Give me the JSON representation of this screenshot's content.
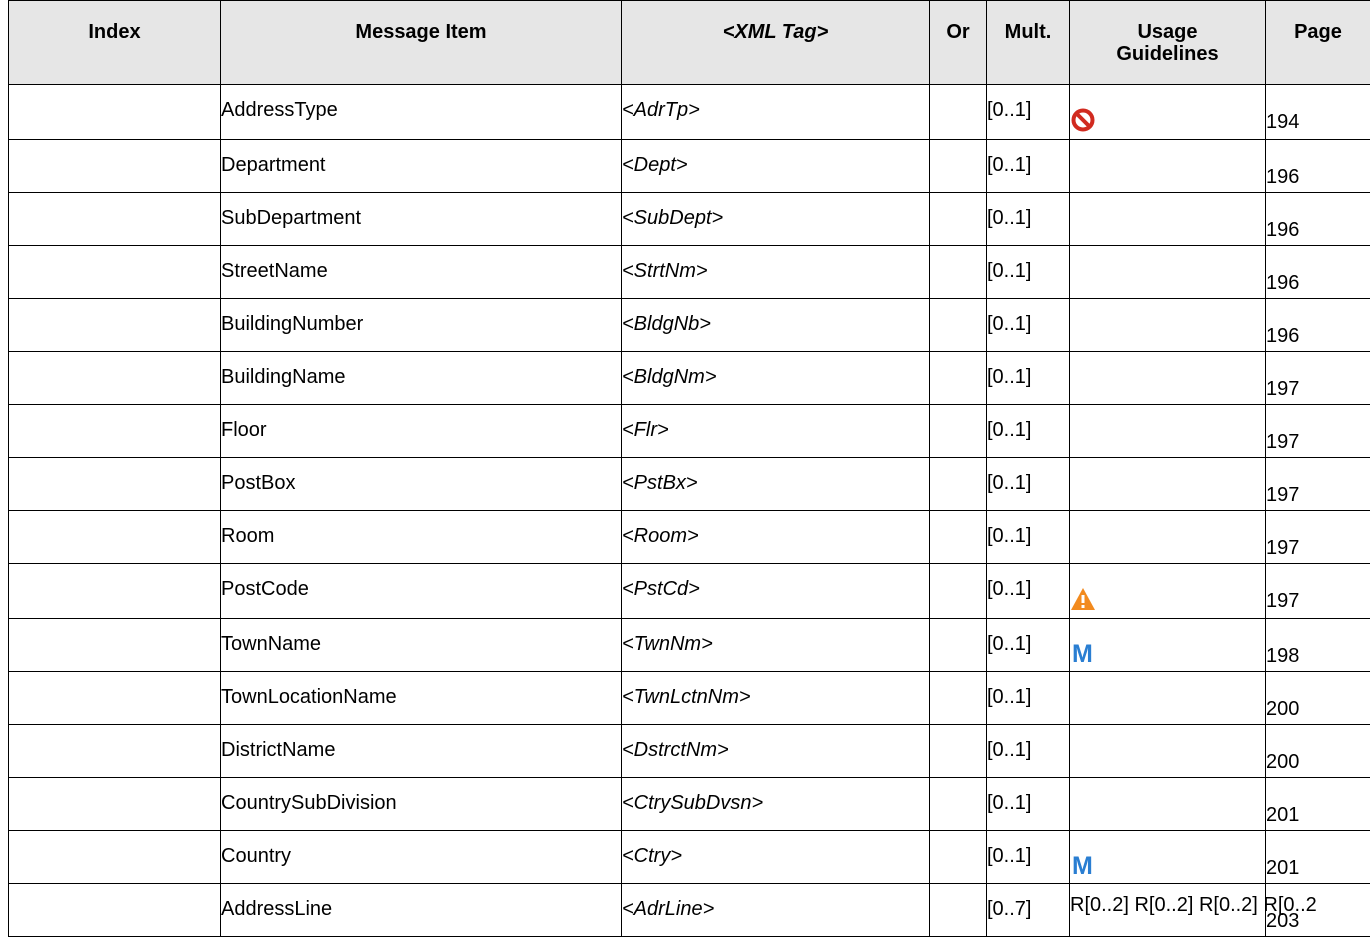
{
  "header": {
    "index": "Index",
    "message_item": "Message Item",
    "xml_tag": "<XML Tag>",
    "or": "Or",
    "mult": "Mult.",
    "usage_line1": "Usage",
    "usage_line2": "Guidelines",
    "page": "Page"
  },
  "rows": [
    {
      "item": "AddressType",
      "tag": "<AdrTp>",
      "mult": "[0..1]",
      "usage_icon": "prohibited-icon",
      "page": "194"
    },
    {
      "item": "Department",
      "tag": "<Dept>",
      "mult": "[0..1]",
      "usage_icon": "",
      "page": "196"
    },
    {
      "item": "SubDepartment",
      "tag": "<SubDept>",
      "mult": "[0..1]",
      "usage_icon": "",
      "page": "196"
    },
    {
      "item": "StreetName",
      "tag": "<StrtNm>",
      "mult": "[0..1]",
      "usage_icon": "",
      "page": "196"
    },
    {
      "item": "BuildingNumber",
      "tag": "<BldgNb>",
      "mult": "[0..1]",
      "usage_icon": "",
      "page": "196"
    },
    {
      "item": "BuildingName",
      "tag": "<BldgNm>",
      "mult": "[0..1]",
      "usage_icon": "",
      "page": "197"
    },
    {
      "item": "Floor",
      "tag": "<Flr>",
      "mult": "[0..1]",
      "usage_icon": "",
      "page": "197"
    },
    {
      "item": "PostBox",
      "tag": "<PstBx>",
      "mult": "[0..1]",
      "usage_icon": "",
      "page": "197"
    },
    {
      "item": "Room",
      "tag": "<Room>",
      "mult": "[0..1]",
      "usage_icon": "",
      "page": "197"
    },
    {
      "item": "PostCode",
      "tag": "<PstCd>",
      "mult": "[0..1]",
      "usage_icon": "warning-icon",
      "page": "197"
    },
    {
      "item": "TownName",
      "tag": "<TwnNm>",
      "mult": "[0..1]",
      "usage_icon": "m-icon",
      "page": "198"
    },
    {
      "item": "TownLocationName",
      "tag": "<TwnLctnNm>",
      "mult": "[0..1]",
      "usage_icon": "",
      "page": "200"
    },
    {
      "item": "DistrictName",
      "tag": "<DstrctNm>",
      "mult": "[0..1]",
      "usage_icon": "",
      "page": "200"
    },
    {
      "item": "CountrySubDivision",
      "tag": "<CtrySubDvsn>",
      "mult": "[0..1]",
      "usage_icon": "",
      "page": "201"
    },
    {
      "item": "Country",
      "tag": "<Ctry>",
      "mult": "[0..1]",
      "usage_icon": "m-icon",
      "page": "201"
    },
    {
      "item": "AddressLine",
      "tag": "<AdrLine>",
      "mult": "[0..7]",
      "usage_icon": "",
      "usage_text": "R[0..2] R[0..2] R[0..2] R[0..2",
      "page": "203"
    }
  ],
  "colors": {
    "header_bg": "#e6e6e6",
    "prohibited": "#d12a1f",
    "warning": "#f28a1e",
    "m_icon": "#2a7ed2"
  }
}
